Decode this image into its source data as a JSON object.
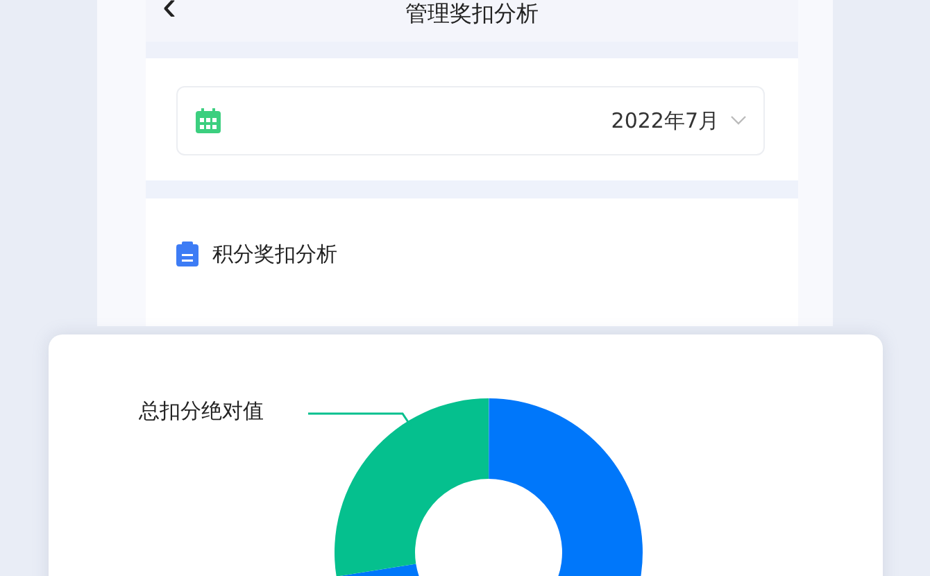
{
  "header": {
    "back": "‹",
    "title": "管理奖扣分析"
  },
  "date_picker": {
    "value": "2022年7月"
  },
  "section": {
    "title": "积分奖扣分析"
  },
  "donut": {
    "label": "总扣分绝对值"
  }
}
